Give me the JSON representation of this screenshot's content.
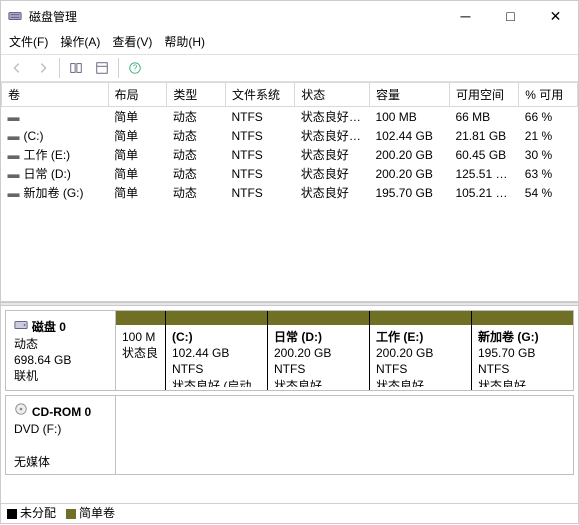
{
  "window": {
    "title": "磁盘管理",
    "min": "─",
    "max": "□",
    "close": "✕"
  },
  "menu": {
    "file": "文件(F)",
    "action": "操作(A)",
    "view": "查看(V)",
    "help": "帮助(H)"
  },
  "columns": {
    "volume": "卷",
    "layout": "布局",
    "type": "类型",
    "fs": "文件系统",
    "status": "状态",
    "capacity": "容量",
    "free": "可用空间",
    "pctfree": "% 可用"
  },
  "rows": [
    {
      "vol": "",
      "layout": "简单",
      "type": "动态",
      "fs": "NTFS",
      "status": "状态良好 (…",
      "cap": "100 MB",
      "free": "66 MB",
      "pct": "66 %"
    },
    {
      "vol": "(C:)",
      "layout": "简单",
      "type": "动态",
      "fs": "NTFS",
      "status": "状态良好 (…",
      "cap": "102.44 GB",
      "free": "21.81 GB",
      "pct": "21 %"
    },
    {
      "vol": "工作 (E:)",
      "layout": "简单",
      "type": "动态",
      "fs": "NTFS",
      "status": "状态良好",
      "cap": "200.20 GB",
      "free": "60.45 GB",
      "pct": "30 %"
    },
    {
      "vol": "日常 (D:)",
      "layout": "简单",
      "type": "动态",
      "fs": "NTFS",
      "status": "状态良好",
      "cap": "200.20 GB",
      "free": "125.51 …",
      "pct": "63 %"
    },
    {
      "vol": "新加卷 (G:)",
      "layout": "简单",
      "type": "动态",
      "fs": "NTFS",
      "status": "状态良好",
      "cap": "195.70 GB",
      "free": "105.21 …",
      "pct": "54 %"
    }
  ],
  "disk0": {
    "header": {
      "name": "磁盘 0",
      "type": "动态",
      "size": "698.64 GB",
      "status": "联机"
    },
    "parts": [
      {
        "title": "",
        "size": "100 M",
        "status": "状态良"
      },
      {
        "title": "(C:)",
        "size": "102.44 GB NTFS",
        "status": "状态良好 (启动, 页面文"
      },
      {
        "title": "日常  (D:)",
        "size": "200.20 GB NTFS",
        "status": "状态良好"
      },
      {
        "title": "工作  (E:)",
        "size": "200.20 GB NTFS",
        "status": "状态良好"
      },
      {
        "title": "新加卷  (G:)",
        "size": "195.70 GB NTFS",
        "status": "状态良好"
      }
    ]
  },
  "cdrom": {
    "header": {
      "name": "CD-ROM 0",
      "type": "DVD (F:)",
      "status": "无媒体"
    }
  },
  "legend": {
    "unalloc": "未分配",
    "simple": "简单卷"
  }
}
